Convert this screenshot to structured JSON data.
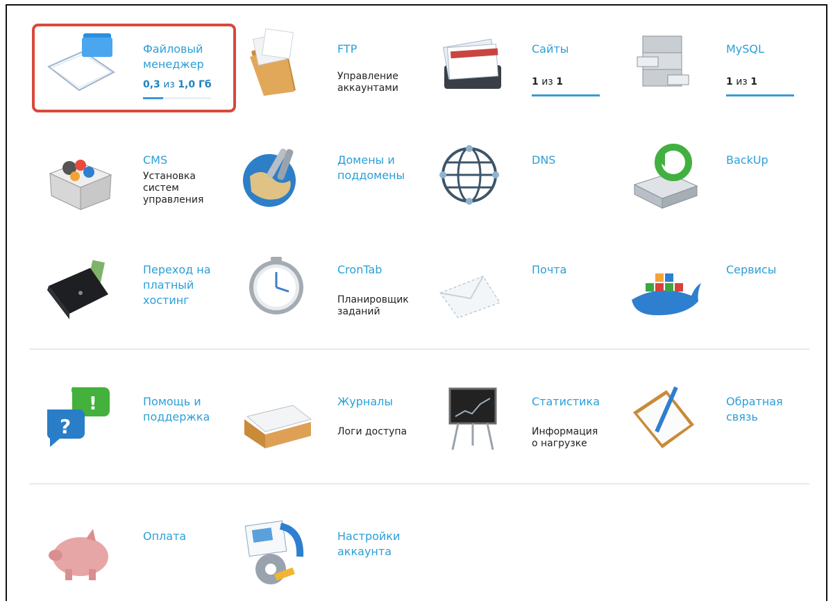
{
  "tiles": {
    "file_manager": {
      "title": "Файловый\nменеджер",
      "used": "0,3",
      "of_word": "из",
      "total": "1,0 Гб",
      "progress": 0.3
    },
    "ftp": {
      "title": "FTP",
      "desc": "Управление\nаккаунтами"
    },
    "sites": {
      "title": "Сайты",
      "used": "1",
      "of_word": "из",
      "total": "1",
      "progress": 1.0
    },
    "mysql": {
      "title": "MySQL",
      "used": "1",
      "of_word": "из",
      "total": "1",
      "progress": 1.0
    },
    "cms": {
      "title": "CMS",
      "desc": "Установка\nсистем\nуправления"
    },
    "domains": {
      "title": "Домены и\nподдомены"
    },
    "dns": {
      "title": "DNS"
    },
    "backup": {
      "title": "BackUp"
    },
    "paid_hosting": {
      "title": "Переход на\nплатный\nхостинг"
    },
    "crontab": {
      "title": "CronTab",
      "desc": "Планировщик\nзаданий"
    },
    "mail": {
      "title": "Почта"
    },
    "services": {
      "title": "Сервисы"
    },
    "help": {
      "title": "Помощь и\nподдержка"
    },
    "logs": {
      "title": "Журналы",
      "desc": "Логи доступа"
    },
    "stats": {
      "title": "Статистика",
      "desc": "Информация\nо нагрузке"
    },
    "feedback": {
      "title": "Обратная\nсвязь"
    },
    "payment": {
      "title": "Оплата"
    },
    "account_settings": {
      "title": "Настройки\nаккаунта"
    }
  },
  "colors": {
    "link": "#2a9fd8",
    "highlight_border": "#d9483b",
    "progress": "#3899d6"
  }
}
